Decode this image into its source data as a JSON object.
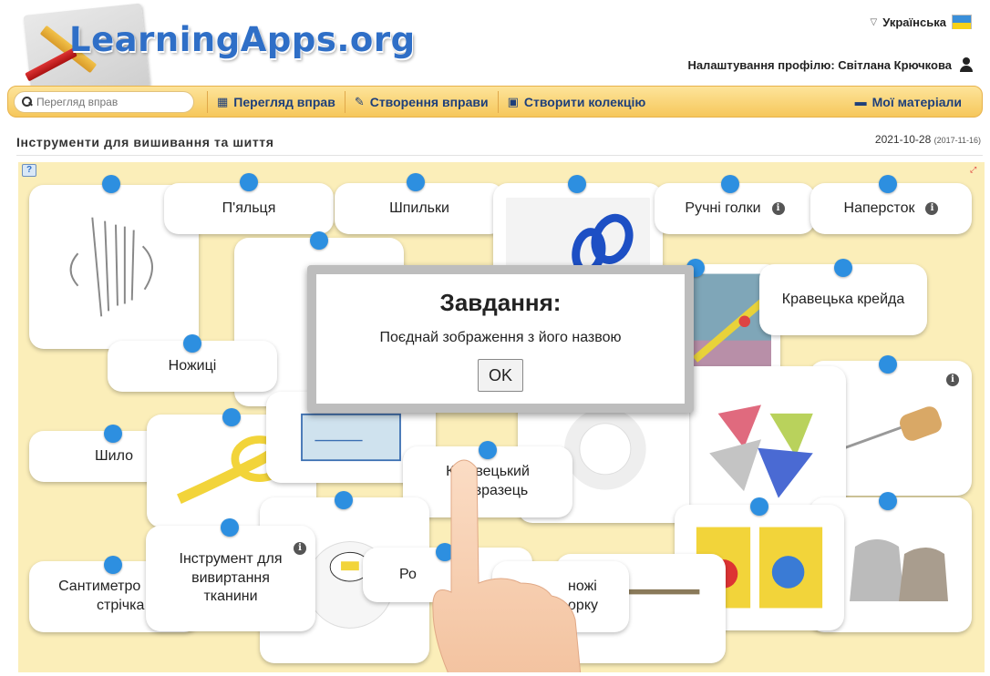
{
  "header": {
    "logo_text": "LearningApps.org",
    "language": "Українська",
    "profile_label": "Налаштування профілю: Світлана Крючкова"
  },
  "toolbar": {
    "search_placeholder": "Перегляд вправ",
    "browse_label": "Перегляд вправ",
    "create_label": "Створення вправи",
    "collection_label": "Створити колекцію",
    "materials_label": "Мої матеріали"
  },
  "page": {
    "title": "Інструменти для вишивання та шиття",
    "date": "2021-10-28",
    "date_small": "(2017-11-16)"
  },
  "cards": {
    "pyaltsia": "П'яльця",
    "shpylky": "Шпильки",
    "ruchni_holky": "Ручні голки",
    "naperstok": "Наперсток",
    "kravetska_kreida": "Кравецька крейда",
    "nozhytsi": "Ножиці",
    "shylo": "Шило",
    "kravetskyi_zrazets": "Кравецький\nзразець",
    "kravetskyi_zrazets_line1": "Кр",
    "kravetskyi_zrazets_line1b": "вецький",
    "kravetskyi_zrazets_line2": "зразець",
    "santymetrova_line1": "Сантиметро",
    "santymetrova_line2": "стрічка",
    "instrument_line1": "Інструмент для",
    "instrument_line2": "вивиртання",
    "instrument_line3": "тканини",
    "ro_partial": "Ро",
    "nozhi_partial_1": "ножі",
    "nozhi_partial_2": "орку"
  },
  "modal": {
    "title": "Завдання:",
    "text": "Поєднай зображення з його назвою",
    "ok": "OK"
  },
  "colors": {
    "toolbar_top": "#fde49a",
    "toolbar_bottom": "#f6c75b",
    "app_background": "#fbeeb9",
    "dot": "#2d8fe0",
    "logo_text": "#2f6fc7"
  }
}
